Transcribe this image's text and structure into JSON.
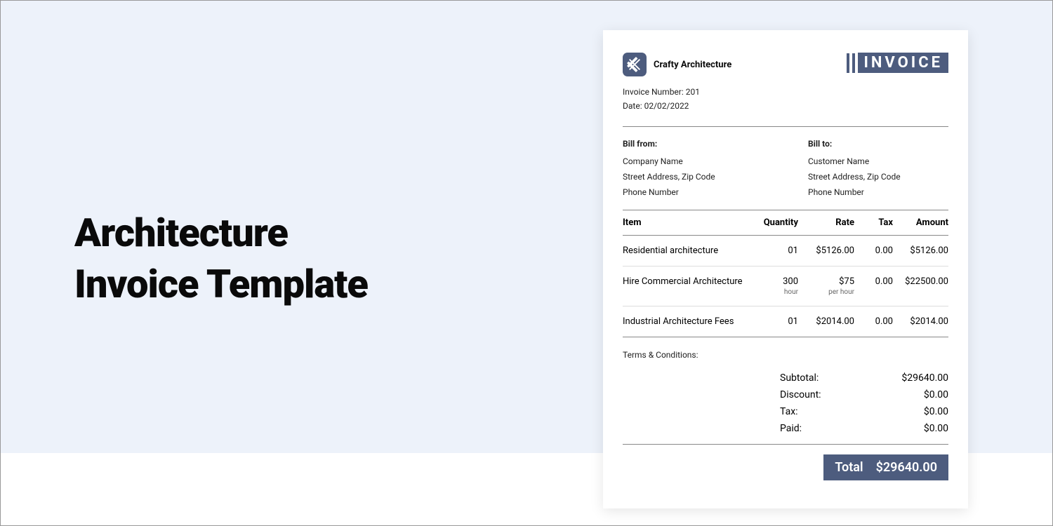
{
  "page": {
    "title_line1": "Architecture",
    "title_line2": "Invoice Template"
  },
  "invoice": {
    "brand_name": "Crafty Architecture",
    "label": "INVOICE",
    "number_label": "Invoice Number: 201",
    "date_label": "Date: 02/02/2022",
    "bill_from": {
      "label": "Bill from:",
      "company": "Company Name",
      "address": "Street Address, Zip Code",
      "phone": "Phone Number"
    },
    "bill_to": {
      "label": "Bill to:",
      "name": "Customer Name",
      "address": "Street Address, Zip Code",
      "phone": "Phone Number"
    },
    "columns": {
      "item": "Item",
      "qty": "Quantity",
      "rate": "Rate",
      "tax": "Tax",
      "amount": "Amount"
    },
    "items": [
      {
        "name": "Residential architecture",
        "qty": "01",
        "qty_sub": "",
        "rate": "$5126.00",
        "rate_sub": "",
        "tax": "0.00",
        "amount": "$5126.00"
      },
      {
        "name": "Hire Commercial Architecture",
        "qty": "300",
        "qty_sub": "hour",
        "rate": "$75",
        "rate_sub": "per hour",
        "tax": "0.00",
        "amount": "$22500.00"
      },
      {
        "name": "Industrial Architecture Fees",
        "qty": "01",
        "qty_sub": "",
        "rate": "$2014.00",
        "rate_sub": "",
        "tax": "0.00",
        "amount": "$2014.00"
      }
    ],
    "terms_label": "Terms & Conditions:",
    "summary": {
      "subtotal_label": "Subtotal:",
      "subtotal": "$29640.00",
      "discount_label": "Discount:",
      "discount": "$0.00",
      "tax_label": "Tax:",
      "tax": "$0.00",
      "paid_label": "Paid:",
      "paid": "$0.00"
    },
    "total_label": "Total",
    "total": "$29640.00"
  }
}
